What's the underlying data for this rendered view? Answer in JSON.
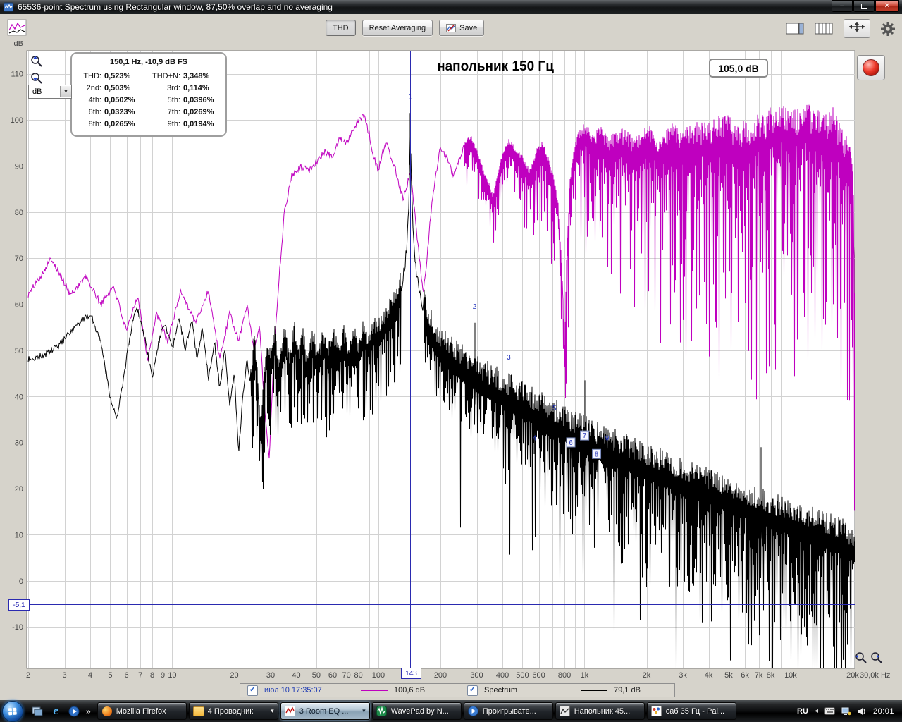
{
  "window": {
    "title": "65536-point Spectrum using Rectangular window, 87,50% overlap and no averaging"
  },
  "icons": {
    "check": "✓",
    "dropdown_arrow": "▼",
    "group_arrow": "▾",
    "overflow_chevron": "»",
    "tray_collapse_arrow": "◂",
    "minimize": "–",
    "close": "✕",
    "ie_letter": "e",
    "media_note": "♪"
  },
  "toolbar": {
    "thd_label": "THD",
    "reset_averaging_label": "Reset Averaging",
    "save_label": "Save"
  },
  "thd_panel": {
    "header": "150,1 Hz, -10,9 dB FS",
    "rows": [
      {
        "l1": "THD:",
        "v1": "0,523%",
        "l2": "THD+N:",
        "v2": "3,348%"
      },
      {
        "l1": "2nd:",
        "v1": "0,503%",
        "l2": "3rd:",
        "v2": "0,114%"
      },
      {
        "l1": "4th:",
        "v1": "0,0502%",
        "l2": "5th:",
        "v2": "0,0396%"
      },
      {
        "l1": "6th:",
        "v1": "0,0323%",
        "l2": "7th:",
        "v2": "0,0269%"
      },
      {
        "l1": "8th:",
        "v1": "0,0265%",
        "l2": "9th:",
        "v2": "0,0194%"
      }
    ]
  },
  "chart": {
    "title": "напольник 150 Гц",
    "level_box": "105,0 dB",
    "unit_select_value": "dB"
  },
  "legend": {
    "spectrum_label": "Spectrum"
  },
  "taskbar": {
    "buttons": [
      {
        "label": "Mozilla Firefox"
      },
      {
        "label": "4 Проводник"
      },
      {
        "label": "3 Room EQ ..."
      },
      {
        "label": "WavePad by N..."
      },
      {
        "label": "Проигрывате..."
      },
      {
        "label": "Напольник 45..."
      },
      {
        "label": "саб 35 Гц - Pai..."
      }
    ],
    "tray": {
      "lang": "RU",
      "clock": "20:01"
    }
  },
  "chart_data": {
    "type": "line",
    "title": "напольник 150 Гц",
    "rms_display": "105,0 dB",
    "grid_color": "#d2d2d2",
    "legend_position": "bottom",
    "x_axis": {
      "scale": "log",
      "unit": "Hz",
      "min": 2,
      "max": 20480,
      "end_label": "30,0k Hz",
      "ticks": [
        [
          2,
          "2"
        ],
        [
          3,
          "3"
        ],
        [
          4,
          "4"
        ],
        [
          5,
          "5"
        ],
        [
          6,
          "6"
        ],
        [
          7,
          "7"
        ],
        [
          8,
          "8"
        ],
        [
          9,
          "9"
        ],
        [
          10,
          "10"
        ],
        [
          20,
          "20"
        ],
        [
          30,
          "30"
        ],
        [
          40,
          "40"
        ],
        [
          50,
          "50"
        ],
        [
          60,
          "60"
        ],
        [
          70,
          "70"
        ],
        [
          80,
          "80"
        ],
        [
          100,
          "100"
        ],
        [
          200,
          "200"
        ],
        [
          300,
          "300"
        ],
        [
          400,
          "400"
        ],
        [
          500,
          "500"
        ],
        [
          600,
          "600"
        ],
        [
          800,
          "800"
        ],
        [
          1000,
          "1k"
        ],
        [
          2000,
          "2k"
        ],
        [
          3000,
          "3k"
        ],
        [
          4000,
          "4k"
        ],
        [
          5000,
          "5k"
        ],
        [
          6000,
          "6k"
        ],
        [
          7000,
          "7k"
        ],
        [
          8000,
          "8k"
        ],
        [
          10000,
          "10k"
        ],
        [
          20000,
          "20k"
        ]
      ]
    },
    "y_axis": {
      "unit": "dB",
      "min": -19,
      "max": 115,
      "ticks": [
        110,
        100,
        90,
        80,
        70,
        60,
        50,
        40,
        30,
        20,
        10,
        0,
        -10
      ]
    },
    "cursor": {
      "freq": 143,
      "freq_label": "143",
      "level_db": -5.1,
      "level_label": "-5,1",
      "color": "#2a2ab0"
    },
    "series": [
      {
        "name": "июл 10 17:35:07",
        "color": "#bf00bf",
        "rms": "100,6 dB",
        "checked": true,
        "seed": 101,
        "envelope": [
          [
            2,
            62
          ],
          [
            2.6,
            70
          ],
          [
            3.2,
            62
          ],
          [
            3.8,
            66
          ],
          [
            4.5,
            60
          ],
          [
            5.2,
            64
          ],
          [
            6,
            54
          ],
          [
            6.8,
            62
          ],
          [
            7.6,
            48
          ],
          [
            8.4,
            58
          ],
          [
            9.5,
            52
          ],
          [
            11,
            63
          ],
          [
            13,
            56
          ],
          [
            15,
            63
          ],
          [
            17,
            48
          ],
          [
            19,
            58
          ],
          [
            21,
            52
          ],
          [
            23,
            60
          ],
          [
            25,
            50
          ],
          [
            26.5,
            56
          ],
          [
            28,
            38
          ],
          [
            29.5,
            26
          ],
          [
            31,
            48
          ],
          [
            33,
            66
          ],
          [
            35,
            80
          ],
          [
            38,
            88
          ],
          [
            42,
            90
          ],
          [
            46,
            89
          ],
          [
            50,
            91
          ],
          [
            55,
            93
          ],
          [
            60,
            92
          ],
          [
            65,
            96
          ],
          [
            70,
            95
          ],
          [
            75,
            98
          ],
          [
            80,
            100
          ],
          [
            85,
            101
          ],
          [
            90,
            97
          ],
          [
            95,
            92
          ],
          [
            100,
            89
          ],
          [
            105,
            93
          ],
          [
            110,
            95
          ],
          [
            115,
            92
          ],
          [
            120,
            90
          ],
          [
            126,
            86
          ],
          [
            132,
            83
          ],
          [
            138,
            86
          ],
          [
            143,
            89
          ],
          [
            150,
            80
          ],
          [
            158,
            70
          ],
          [
            165,
            62
          ],
          [
            172,
            70
          ],
          [
            180,
            80
          ],
          [
            190,
            88
          ],
          [
            200,
            94
          ],
          [
            215,
            92
          ],
          [
            230,
            88
          ],
          [
            245,
            91
          ],
          [
            260,
            94
          ],
          [
            280,
            96
          ],
          [
            300,
            93
          ],
          [
            320,
            89
          ],
          [
            340,
            86
          ],
          [
            360,
            83
          ],
          [
            380,
            88
          ],
          [
            400,
            92
          ],
          [
            430,
            95
          ],
          [
            460,
            93
          ],
          [
            500,
            91
          ],
          [
            540,
            88
          ],
          [
            580,
            92
          ],
          [
            620,
            94
          ],
          [
            660,
            91
          ],
          [
            700,
            87
          ],
          [
            740,
            82
          ],
          [
            780,
            65
          ],
          [
            800,
            50
          ],
          [
            820,
            70
          ],
          [
            850,
            86
          ],
          [
            900,
            93
          ],
          [
            950,
            96
          ],
          [
            1000,
            97
          ],
          [
            1100,
            94
          ],
          [
            1200,
            96
          ],
          [
            1300,
            93
          ],
          [
            1500,
            95
          ],
          [
            1700,
            93
          ],
          [
            2000,
            95
          ],
          [
            2300,
            93
          ],
          [
            2600,
            95
          ],
          [
            3000,
            93
          ],
          [
            3500,
            95
          ],
          [
            4000,
            94
          ],
          [
            4500,
            96
          ],
          [
            5000,
            95
          ],
          [
            5500,
            93
          ],
          [
            6000,
            95
          ],
          [
            6500,
            94
          ],
          [
            7000,
            96
          ],
          [
            7500,
            95
          ],
          [
            8000,
            97
          ],
          [
            8500,
            96
          ],
          [
            9000,
            98
          ],
          [
            10000,
            96
          ],
          [
            11000,
            97
          ],
          [
            12000,
            98
          ],
          [
            13000,
            96
          ],
          [
            14000,
            97
          ],
          [
            15000,
            95
          ],
          [
            16000,
            97
          ],
          [
            17000,
            94
          ],
          [
            18000,
            92
          ],
          [
            19000,
            90
          ],
          [
            20000,
            87
          ],
          [
            20500,
            60
          ]
        ]
      },
      {
        "name": "Spectrum",
        "color": "#000000",
        "rms": "79,1 dB",
        "checked": true,
        "seed": 202,
        "envelope": [
          [
            2,
            48
          ],
          [
            2.4,
            49
          ],
          [
            2.8,
            51
          ],
          [
            3.4,
            55
          ],
          [
            4,
            58
          ],
          [
            4.5,
            52
          ],
          [
            5,
            40
          ],
          [
            5.4,
            35
          ],
          [
            5.8,
            44
          ],
          [
            6.4,
            56
          ],
          [
            6.8,
            59
          ],
          [
            7.4,
            52
          ],
          [
            8,
            44
          ],
          [
            8.6,
            52
          ],
          [
            9.2,
            56
          ],
          [
            10,
            50
          ],
          [
            10.8,
            57
          ],
          [
            11.6,
            50
          ],
          [
            12.4,
            57
          ],
          [
            13.2,
            48
          ],
          [
            14,
            55
          ],
          [
            15,
            44
          ],
          [
            16,
            52
          ],
          [
            17,
            42
          ],
          [
            18,
            50
          ],
          [
            19,
            38
          ],
          [
            20,
            45
          ],
          [
            21,
            28
          ],
          [
            22,
            40
          ],
          [
            23,
            48
          ],
          [
            24,
            43
          ],
          [
            25,
            51
          ],
          [
            26,
            42
          ],
          [
            27,
            31
          ],
          [
            28,
            44
          ],
          [
            29,
            50
          ],
          [
            30,
            46
          ],
          [
            31.5,
            52
          ],
          [
            33,
            44
          ],
          [
            35,
            52
          ],
          [
            37,
            46
          ],
          [
            39,
            53
          ],
          [
            41,
            47
          ],
          [
            43,
            52
          ],
          [
            45,
            46
          ],
          [
            48,
            51
          ],
          [
            51,
            47
          ],
          [
            54,
            51
          ],
          [
            57,
            47
          ],
          [
            60,
            52
          ],
          [
            64,
            48
          ],
          [
            68,
            52
          ],
          [
            72,
            48
          ],
          [
            76,
            52
          ],
          [
            80,
            49
          ],
          [
            85,
            53
          ],
          [
            90,
            50
          ],
          [
            95,
            54
          ],
          [
            100,
            53
          ],
          [
            106,
            55
          ],
          [
            112,
            57
          ],
          [
            118,
            59
          ],
          [
            124,
            61
          ],
          [
            130,
            64
          ],
          [
            134,
            68
          ],
          [
            137,
            72
          ],
          [
            139,
            77
          ],
          [
            141,
            84
          ],
          [
            142,
            90
          ],
          [
            143,
            101
          ],
          [
            144,
            91
          ],
          [
            145,
            84
          ],
          [
            147,
            77
          ],
          [
            150,
            71
          ],
          [
            154,
            66
          ],
          [
            158,
            63
          ],
          [
            163,
            60
          ],
          [
            168,
            58
          ],
          [
            174,
            56
          ],
          [
            180,
            54
          ],
          [
            188,
            52
          ],
          [
            196,
            51
          ],
          [
            205,
            50
          ],
          [
            215,
            49
          ],
          [
            230,
            48
          ],
          [
            245,
            47
          ],
          [
            260,
            46
          ],
          [
            280,
            45
          ],
          [
            300,
            44
          ],
          [
            330,
            43
          ],
          [
            360,
            42
          ],
          [
            400,
            41
          ],
          [
            440,
            40
          ],
          [
            480,
            39
          ],
          [
            520,
            38
          ],
          [
            570,
            37
          ],
          [
            620,
            36
          ],
          [
            680,
            35
          ],
          [
            750,
            34
          ],
          [
            820,
            33
          ],
          [
            900,
            32
          ],
          [
            1000,
            31
          ],
          [
            1100,
            30
          ],
          [
            1250,
            29
          ],
          [
            1400,
            28
          ],
          [
            1600,
            27
          ],
          [
            1800,
            26
          ],
          [
            2000,
            25
          ],
          [
            2300,
            24
          ],
          [
            2600,
            23
          ],
          [
            3000,
            22
          ],
          [
            3400,
            21
          ],
          [
            3900,
            20
          ],
          [
            4400,
            19
          ],
          [
            5000,
            18
          ],
          [
            5700,
            17
          ],
          [
            6500,
            16
          ],
          [
            7400,
            15
          ],
          [
            8500,
            14
          ],
          [
            10000,
            13
          ],
          [
            11500,
            12
          ],
          [
            13000,
            11
          ],
          [
            15000,
            10
          ],
          [
            17000,
            9
          ],
          [
            19000,
            8
          ],
          [
            20500,
            7
          ]
        ],
        "spikes": [
          [
            143,
            101.5
          ],
          [
            293,
            56
          ],
          [
            429,
            45
          ],
          [
            572,
            27.5
          ],
          [
            715,
            34
          ],
          [
            858,
            26.5
          ],
          [
            1001,
            43.5
          ],
          [
            1144,
            25
          ],
          [
            1287,
            28
          ],
          [
            7200,
            29
          ]
        ],
        "harmonic_markers": [
          {
            "n": "1",
            "f": 143,
            "db": 104.5,
            "boxed": false
          },
          {
            "n": "2",
            "f": 293,
            "db": 59,
            "boxed": false
          },
          {
            "n": "3",
            "f": 429,
            "db": 48,
            "boxed": false
          },
          {
            "n": "4",
            "f": 572,
            "db": 30.5,
            "boxed": false
          },
          {
            "n": "5",
            "f": 715,
            "db": 37,
            "boxed": false
          },
          {
            "n": "6",
            "f": 858,
            "db": 29.5,
            "boxed": true
          },
          {
            "n": "7",
            "f": 1001,
            "db": 31,
            "boxed": true
          },
          {
            "n": "8",
            "f": 1144,
            "db": 27,
            "boxed": true
          },
          {
            "n": "9",
            "f": 1287,
            "db": 30.5,
            "boxed": false
          }
        ]
      }
    ]
  }
}
